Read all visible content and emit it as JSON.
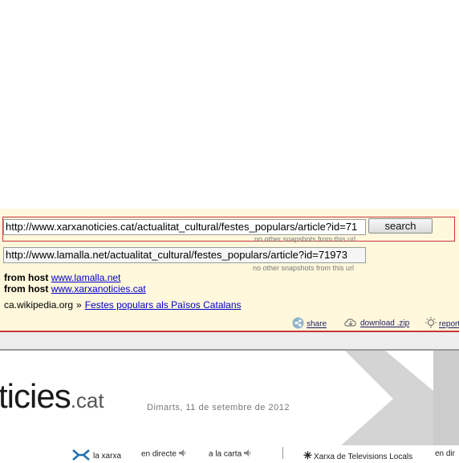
{
  "toolbar": {
    "main_url": "http://www.xarxanoticies.cat/actualitat_cultural/festes_populars/article?id=71",
    "search_label": "search",
    "note_no_snapshots_1": "no other snapshots from this url",
    "second_url": "http://www.lamalla.net/actualitat_cultural/festes_populars/article?id=71973",
    "note_no_snapshots_2": "no other snapshots from this url",
    "from_host_label": "from host",
    "host_1": "www.lamalla.net",
    "host_2": "www.xarxanoticies.cat",
    "wiki_source": "ca.wikipedia.org",
    "wiki_sep": "»",
    "wiki_link": "Festes populars als Països Catalans",
    "share_label": "share",
    "download_label": "download .zip",
    "report_label": "report"
  },
  "site": {
    "logo_text": "ticies",
    "logo_suffix": ".cat",
    "date": "Dimarts, 11 de setembre de 2012",
    "nav": {
      "xarxa": "la xarxa",
      "directe": "en directe",
      "carta": "a la carta",
      "tv": "Xarxa de Televisions Locals",
      "directe2": "en dir"
    }
  },
  "colors": {
    "toolbar_bg": "#fff8dc",
    "accent_red": "#c8363a",
    "link_blue": "#0000cc"
  }
}
